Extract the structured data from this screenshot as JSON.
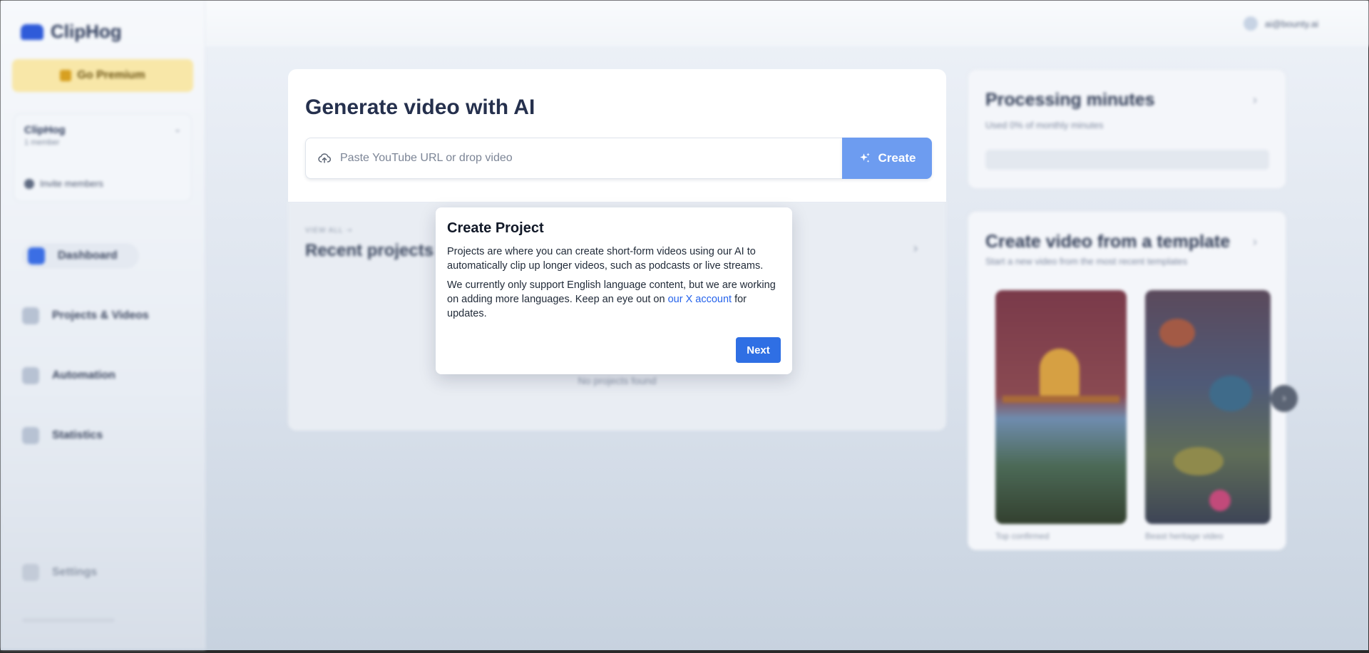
{
  "sidebar": {
    "brand": "ClipHog",
    "premium_label": "Go Premium",
    "workspace": {
      "name": "ClipHog",
      "members": "1 member",
      "invite_label": "Invite members"
    },
    "items": [
      {
        "label": "Dashboard"
      },
      {
        "label": "Projects & Videos"
      },
      {
        "label": "Automation"
      },
      {
        "label": "Statistics"
      }
    ],
    "settings_label": "Settings"
  },
  "header": {
    "user_email": "ai@bounty.ai"
  },
  "generate": {
    "title": "Generate video with AI",
    "input_placeholder": "Paste YouTube URL or drop video",
    "create_label": "Create"
  },
  "recent": {
    "eyebrow": "VIEW ALL ⇢",
    "title": "Recent projects",
    "empty_text": "No projects found"
  },
  "processing": {
    "title": "Processing minutes",
    "subtitle": "Used 0% of monthly minutes"
  },
  "templates": {
    "title": "Create video from a template",
    "subtitle": "Start a new video from the most recent templates",
    "items": [
      {
        "caption": "Top confirmed"
      },
      {
        "caption": "Beast heritage video"
      }
    ]
  },
  "modal": {
    "title": "Create Project",
    "paragraph1": "Projects are where you can create short-form videos using our AI to automatically clip up longer videos, such as podcasts or live streams.",
    "paragraph2_before": "We currently only support English language content, but we are working on adding more languages. Keep an eye out on ",
    "paragraph2_link": "our X account",
    "paragraph2_after": " for updates.",
    "next_label": "Next"
  },
  "colors": {
    "accent": "#2f6fe4",
    "create_button": "#6d9cf0",
    "link": "#2563eb",
    "premium_bg": "#f8e7a8"
  },
  "icons": {
    "upload": "cloud-upload-icon",
    "create": "sparkles-icon",
    "template_next": "chevron-right-icon"
  }
}
